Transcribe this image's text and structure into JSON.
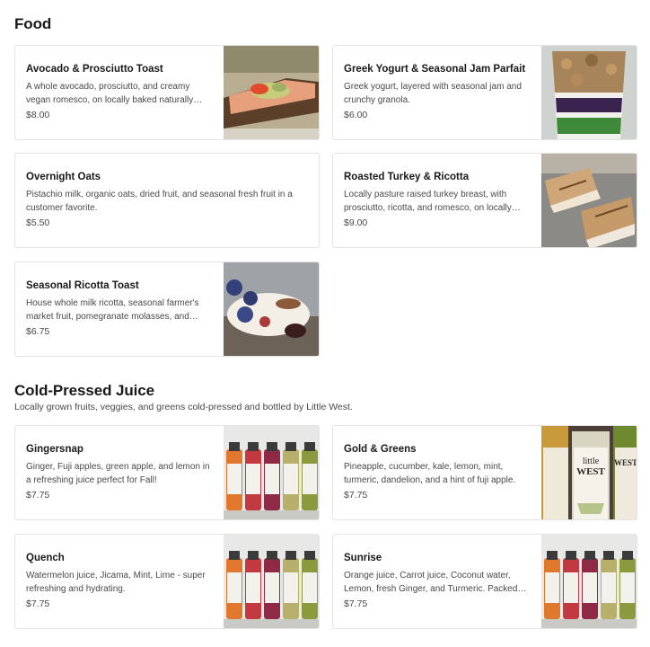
{
  "sections": [
    {
      "title": "Food",
      "description": "",
      "items": [
        {
          "name": "Avocado & Prosciutto Toast",
          "description": "A whole avocado, prosciutto, and creamy vegan romesco, on locally baked naturally leavened bread.",
          "price": "$8.00",
          "image": "avocado-toast-image"
        },
        {
          "name": "Greek Yogurt & Seasonal Jam Parfait",
          "description": "Greek yogurt, layered with seasonal jam and crunchy granola.",
          "price": "$6.00",
          "image": "parfait-image"
        },
        {
          "name": "Overnight Oats",
          "description": "Pistachio milk, organic oats, dried fruit, and seasonal fresh fruit in a customer favorite.",
          "price": "$5.50",
          "image": ""
        },
        {
          "name": "Roasted Turkey & Ricotta",
          "description": "Locally pasture raised turkey breast, with prosciutto, ricotta, and romesco, on locally baked bread.",
          "price": "$9.00",
          "image": "turkey-sandwich-image"
        },
        {
          "name": "Seasonal Ricotta Toast",
          "description": "House whole milk ricotta, seasonal farmer's market fruit, pomegranate molasses, and honey.",
          "price": "$6.75",
          "image": "ricotta-toast-image"
        }
      ]
    },
    {
      "title": "Cold-Pressed Juice",
      "description": "Locally grown fruits, veggies, and greens cold-pressed and bottled by Little West.",
      "items": [
        {
          "name": "Gingersnap",
          "description": "Ginger, Fuji apples, green apple, and lemon in a refreshing juice perfect for Fall!",
          "price": "$7.75",
          "image": "juice-bottles-image"
        },
        {
          "name": "Gold & Greens",
          "description": "Pineapple, cucumber, kale, lemon, mint, turmeric, dandelion, and a hint of fuji apple.",
          "price": "$7.75",
          "image": "little-west-bottles-image"
        },
        {
          "name": "Quench",
          "description": "Watermelon juice, Jicama, Mint, Lime - super refreshing and hydrating.",
          "price": "$7.75",
          "image": "juice-bottles-image"
        },
        {
          "name": "Sunrise",
          "description": "Orange juice, Carrot juice, Coconut water, Lemon, fresh Ginger, and Turmeric. Packed with vitamins.",
          "price": "$7.75",
          "image": "juice-bottles-image"
        }
      ]
    }
  ],
  "bottle_label_text": "little WEST",
  "colors": {
    "text_primary": "#191919",
    "text_secondary": "#494949",
    "card_border": "#e4e4e4",
    "juice_orange": "#e0782e",
    "juice_red": "#c23a3f",
    "juice_crimson": "#8e2a45",
    "juice_green": "#8a9a3c"
  }
}
